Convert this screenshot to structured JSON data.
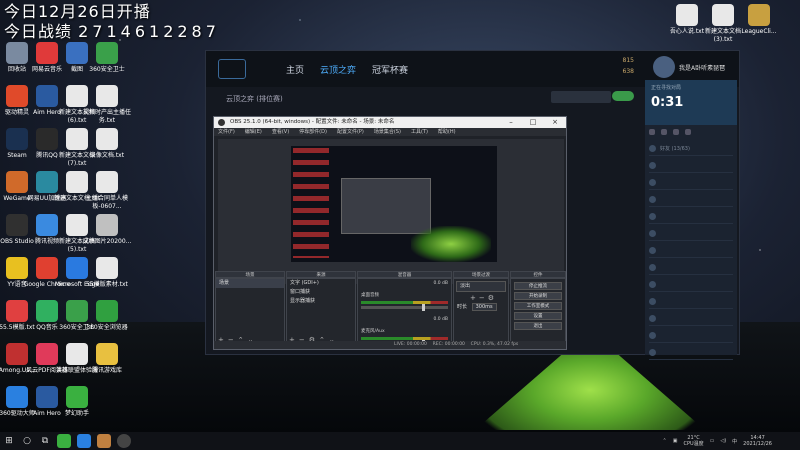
{
  "overlay": {
    "line1": "今日12月26日开播",
    "line2_prefix": "今日战绩",
    "line2_id": "2714612287"
  },
  "desktop_left": [
    {
      "label": "回收站",
      "color": "#7a8aa0"
    },
    {
      "label": "网易云音乐",
      "color": "#e03a3a"
    },
    {
      "label": "截图",
      "color": "#3a70c0"
    },
    {
      "label": "360安全卫士",
      "color": "#3aa04a"
    },
    {
      "label": "驱动精灵",
      "color": "#e04a2a"
    },
    {
      "label": "Aim Hero",
      "color": "#2a5aa0"
    },
    {
      "label": "新建文本文档(6).txt",
      "color": "#e8e8e8"
    },
    {
      "label": "视频时产出主播任务.txt",
      "color": "#e8e8e8"
    },
    {
      "label": "Steam",
      "color": "#1a3050"
    },
    {
      "label": "腾讯QQ",
      "color": "#2a2a2a"
    },
    {
      "label": "新建文本文档(7).txt",
      "color": "#e8e8e8"
    },
    {
      "label": "录像文档.txt",
      "color": "#e8e8e8"
    },
    {
      "label": "WeGame",
      "color": "#d06a2a"
    },
    {
      "label": "网易UU加速器",
      "color": "#2a8aa0"
    },
    {
      "label": "新建文本文档.txt",
      "color": "#e8e8e8"
    },
    {
      "label": "主播合同单人模板-0607...",
      "color": "#e8e8e8"
    },
    {
      "label": "OBS Studio",
      "color": "#303030"
    },
    {
      "label": "腾讯视频",
      "color": "#3a8ae0"
    },
    {
      "label": "新建文本文档(5).txt",
      "color": "#e8e8e8"
    },
    {
      "label": "成绩图片20200...",
      "color": "#c0c0c0"
    },
    {
      "label": "YY语音",
      "color": "#e8c020"
    },
    {
      "label": "Google Chrome",
      "color": "#e04030"
    },
    {
      "label": "Microsoft Edge",
      "color": "#2a7ae0"
    },
    {
      "label": "55模版素材.txt",
      "color": "#e8e8e8"
    },
    {
      "label": "55.5模版.txt",
      "color": "#e04040"
    },
    {
      "label": "QQ音乐",
      "color": "#30b060"
    },
    {
      "label": "360安全卫士",
      "color": "#3aa04a"
    },
    {
      "label": "360安全浏览器",
      "color": "#30a040"
    },
    {
      "label": "Among.Us...",
      "color": "#c03030"
    },
    {
      "label": "风云PDF阅读器",
      "color": "#e03a5a"
    },
    {
      "label": "英雄联盟体验服",
      "color": "#e8e8e8"
    },
    {
      "label": "腾讯游戏库",
      "color": "#e8c040"
    },
    {
      "label": "360驱动大师",
      "color": "#2a80e0"
    },
    {
      "label": "Aim Hero",
      "color": "#2a5aa0"
    },
    {
      "label": "梦幻助手",
      "color": "#3ab040"
    }
  ],
  "desktop_right": [
    {
      "label": "吾心人说.txt",
      "color": "#e8e8e8"
    },
    {
      "label": "新建文本文档(3).txt",
      "color": "#e8e8e8"
    },
    {
      "label": "LeagueCli...",
      "color": "#c8a040"
    }
  ],
  "client": {
    "nav": [
      "主页",
      "云顶之弈",
      "冠军杯赛"
    ],
    "active_nav": 1,
    "subbar": "云顶之弈 (排位赛)",
    "stat1": "815",
    "stat2": "638",
    "profile_name": "我是A卧听素琵琶",
    "side_small": "正在寻找对局",
    "side_timer": "0:31",
    "side_rows": [
      "好友 (13/63)",
      "",
      "",
      "",
      "",
      "",
      "",
      "",
      "",
      "",
      "",
      "",
      ""
    ]
  },
  "obs": {
    "title": "OBS 25.1.0 (64-bit, windows) - 配置文件: 未命名 - 场景: 未命名",
    "menu": [
      "文件(F)",
      "编辑(E)",
      "查看(V)",
      "停靠部件(D)",
      "配置文件(P)",
      "场景集合(S)",
      "工具(T)",
      "帮助(H)"
    ],
    "docks": {
      "scenes": {
        "header": "场景",
        "items": [
          "场景"
        ]
      },
      "sources": {
        "header": "来源",
        "items": [
          "文字 (GDI+)",
          "窗口捕获",
          "显示器捕获"
        ]
      },
      "mixer": {
        "header": "混音器",
        "rows": [
          {
            "label": "桌面音频",
            "level": "0.0 dB"
          },
          {
            "label": "麦克风/Aux",
            "level": "0.0 dB"
          }
        ]
      },
      "transitions": {
        "header": "场景过渡",
        "type": "淡出",
        "duration_label": "时长",
        "duration_value": "300ms"
      },
      "controls": {
        "header": "控件",
        "buttons": [
          "停止推流",
          "开始录制",
          "工作室模式",
          "设置",
          "退出"
        ]
      }
    },
    "status": {
      "live": "LIVE: 00:00:00",
      "rec": "REC: 00:00:00",
      "cpu": "CPU: 0.3%, 47.02 fps"
    }
  },
  "taskbar": {
    "temp": "21°C",
    "weather_label": "CPU温度",
    "time": "14:47",
    "date": "2021/12/26"
  }
}
